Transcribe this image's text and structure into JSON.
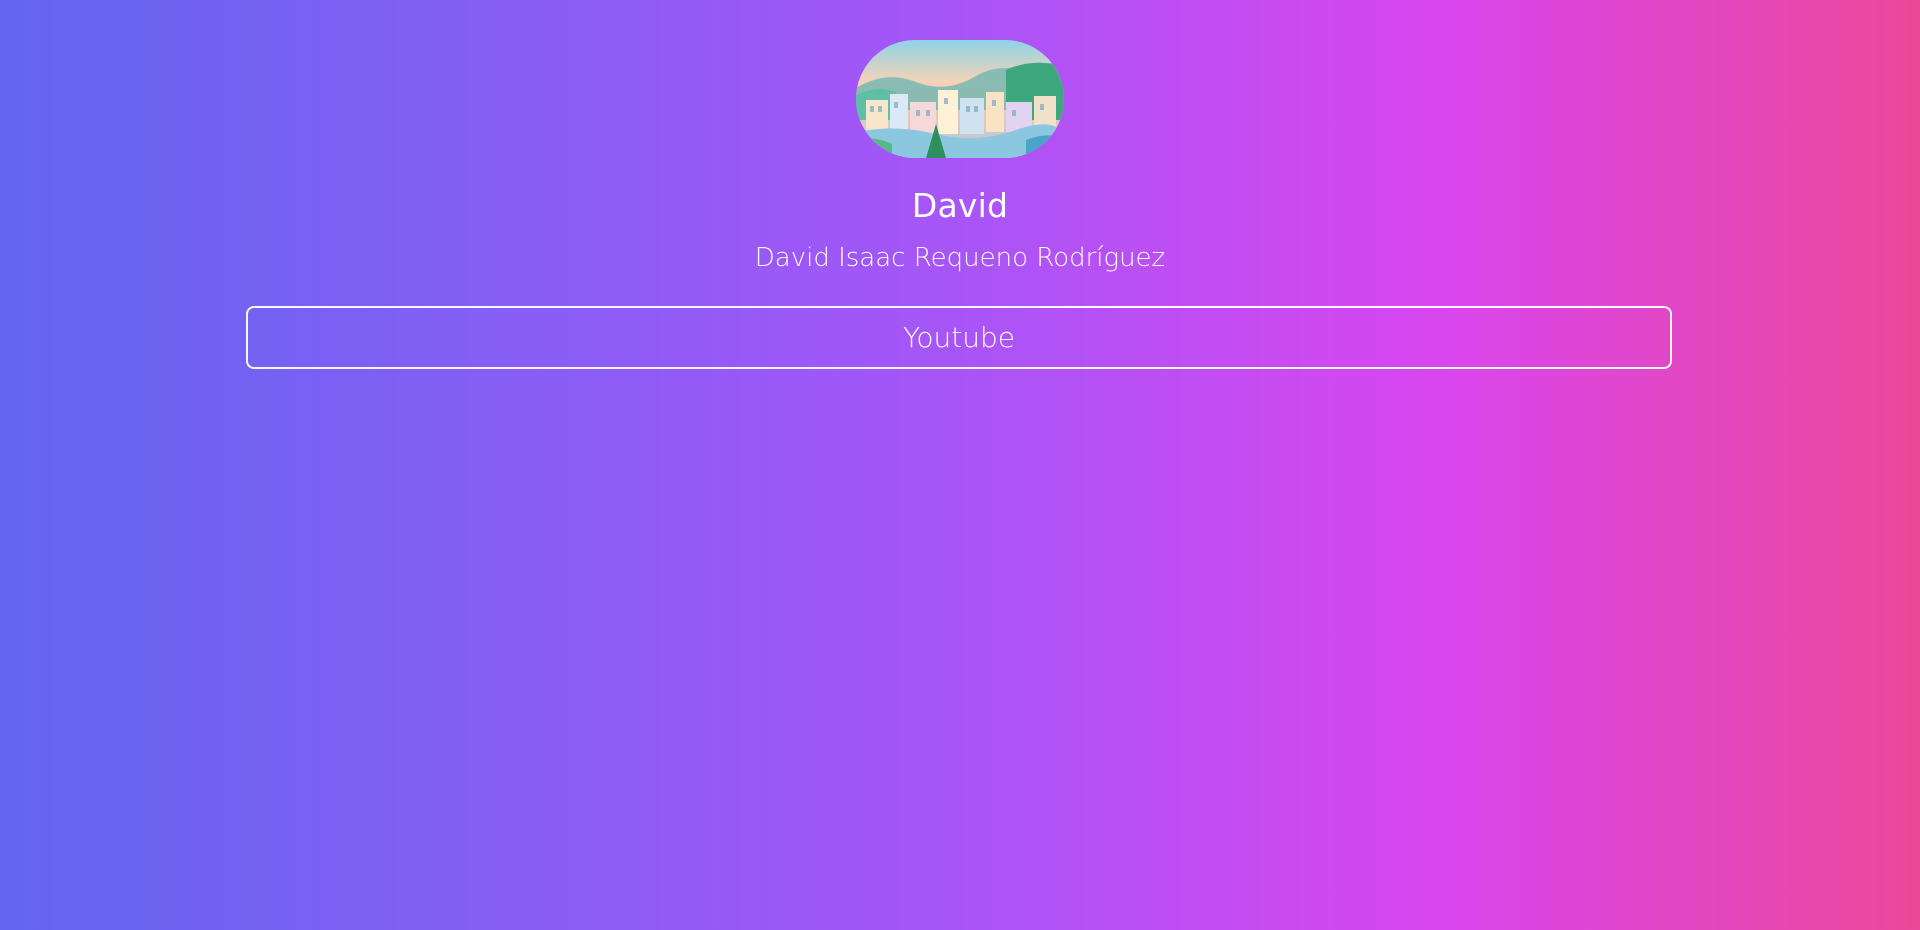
{
  "profile": {
    "display_name": "David",
    "full_name": "David Isaac Requeno Rodríguez"
  },
  "links": [
    {
      "label": "Youtube"
    }
  ],
  "colors": {
    "gradient_start": "#6366f1",
    "gradient_mid": "#a855f7",
    "gradient_end": "#ec4899",
    "text": "#ffffff"
  }
}
